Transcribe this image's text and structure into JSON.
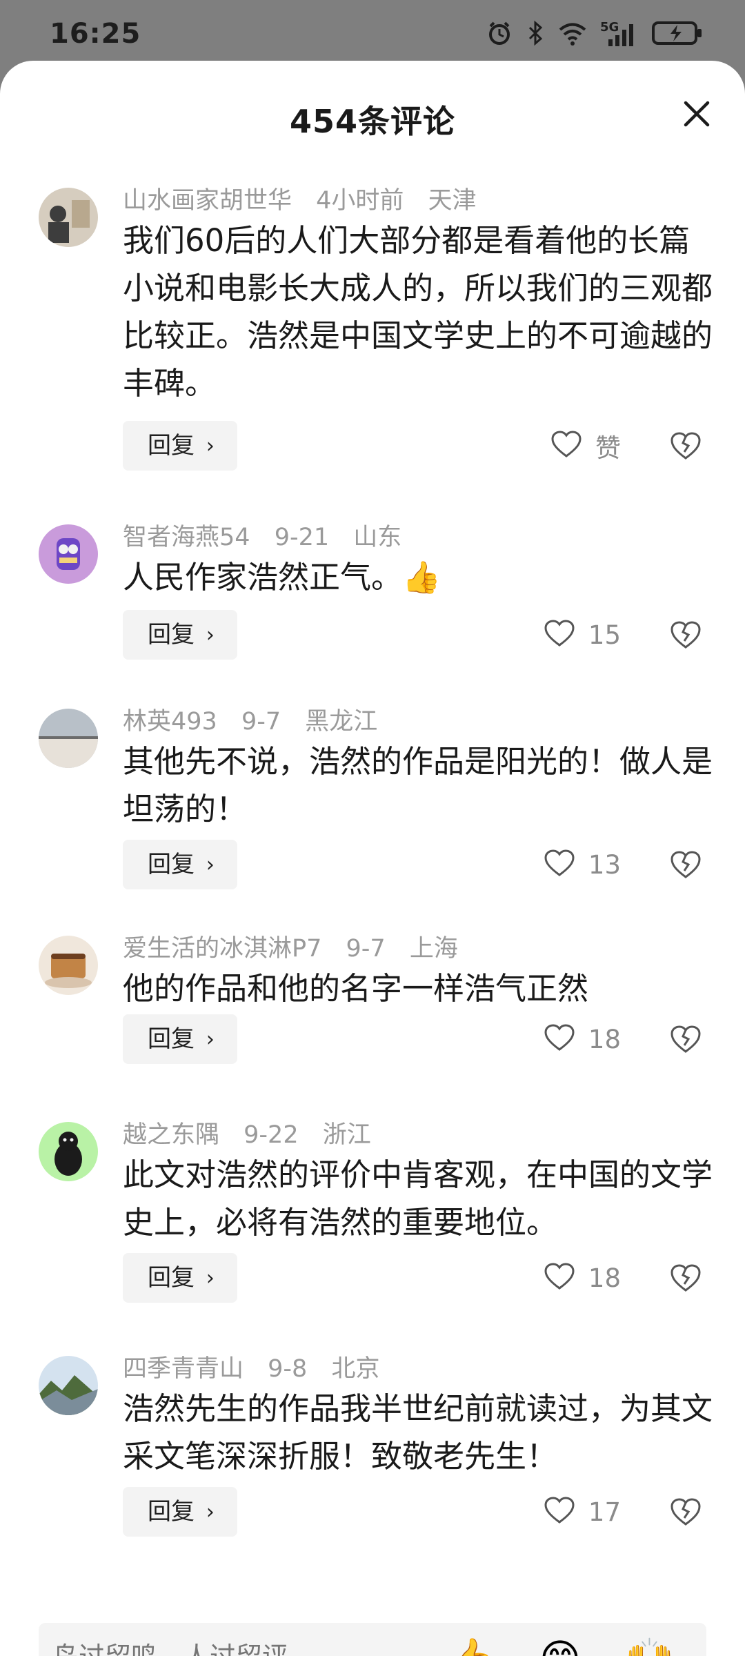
{
  "status_bar": {
    "time": "16:25",
    "network": "5G"
  },
  "sheet": {
    "title": "454条评论"
  },
  "comments": [
    {
      "name": "山水画家胡世华",
      "time": "4小时前",
      "location": "天津",
      "text": "我们60后的人们大部分都是看着他的长篇小说和电影长大成人的，所以我们的三观都比较正。浩然是中国文学史上的不可逾越的丰碑。",
      "reply_label": "回复",
      "likes": "赞",
      "avatar_colors": [
        "#d6cdbf",
        "#3d3d3d",
        "#b8a88e"
      ]
    },
    {
      "name": "智者海燕54",
      "time": "9-21",
      "location": "山东",
      "text": "人民作家浩然正气。👍",
      "reply_label": "回复",
      "likes": "15",
      "avatar_colors": [
        "#c99bdb",
        "#6d47c6",
        "#f4d37a"
      ]
    },
    {
      "name": "林英493",
      "time": "9-7",
      "location": "黑龙江",
      "text": "其他先不说，浩然的作品是阳光的！做人是坦荡的！",
      "reply_label": "回复",
      "likes": "13",
      "avatar_colors": [
        "#b8c0c8",
        "#e7e1d9",
        "#6b6b6b"
      ]
    },
    {
      "name": "爱生活的冰淇淋P7",
      "time": "9-7",
      "location": "上海",
      "text": "他的作品和他的名字一样浩气正然",
      "reply_label": "回复",
      "likes": "18",
      "avatar_colors": [
        "#f0e7dc",
        "#c28446",
        "#6e3f1f"
      ]
    },
    {
      "name": "越之东隅",
      "time": "9-22",
      "location": "浙江",
      "text": "此文对浩然的评价中肯客观，在中国的文学史上，必将有浩然的重要地位。",
      "reply_label": "回复",
      "likes": "18",
      "avatar_colors": [
        "#b9f2a6",
        "#1b1b1b",
        "#f2f2f2"
      ]
    },
    {
      "name": "四季青青山",
      "time": "9-8",
      "location": "北京",
      "text": "浩然先生的作品我半世纪前就读过，为其文采文笔深深折服！致敬老先生！",
      "reply_label": "回复",
      "likes": "17",
      "avatar_colors": [
        "#d4e2ef",
        "#4e6b3c",
        "#7b8d9a"
      ]
    }
  ],
  "bottom": {
    "placeholder": "鸟过留鸣，人过留评",
    "emojis": [
      "👍",
      "😁",
      "🙌"
    ]
  }
}
